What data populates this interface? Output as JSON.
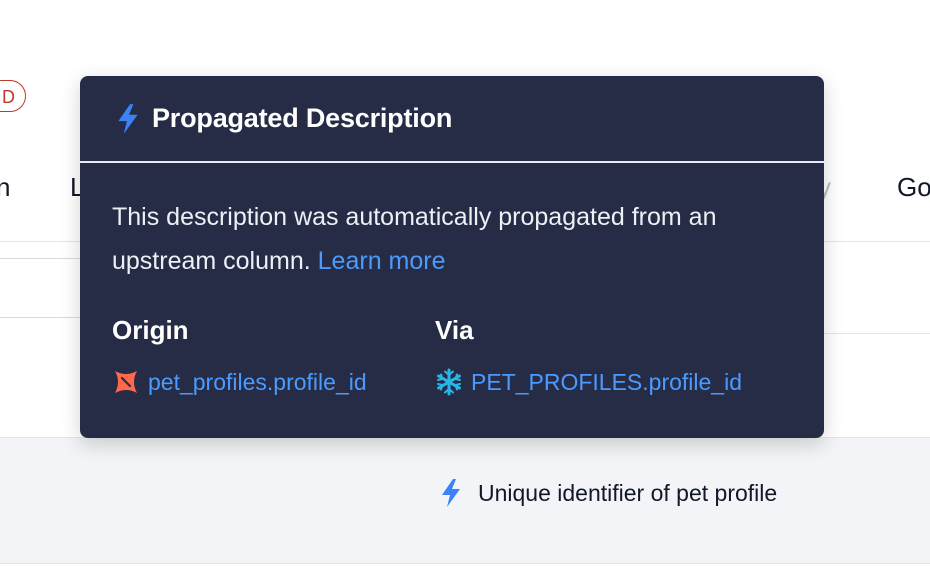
{
  "background": {
    "badge_text": "D",
    "tab_fragments": [
      "n",
      "L",
      "y",
      "Go"
    ],
    "description": {
      "text": "Unique identifier of pet profile",
      "icon": "lightning-icon"
    }
  },
  "tooltip": {
    "title": "Propagated Description",
    "title_icon": "lightning-icon",
    "message": "This description was automatically propagated from an upstream column.",
    "learn_more": "Learn more",
    "origin": {
      "heading": "Origin",
      "icon": "dbt-icon",
      "ref": "pet_profiles.profile_id"
    },
    "via": {
      "heading": "Via",
      "icon": "snowflake-icon",
      "ref": "PET_PROFILES.profile_id"
    }
  },
  "colors": {
    "tooltip_bg": "#262c45",
    "link": "#4b9bff",
    "lightning": "#3b82f6",
    "dbt": "#ff694a",
    "snowflake": "#29b5e8",
    "badge": "#c0392b"
  }
}
